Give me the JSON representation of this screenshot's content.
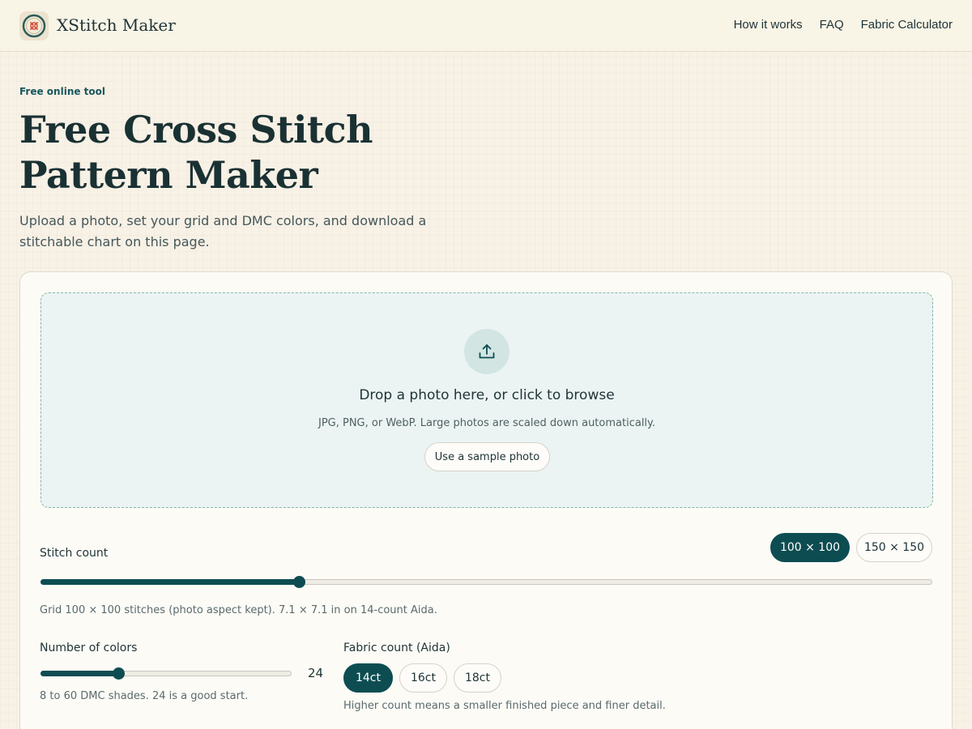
{
  "header": {
    "brand": "XStitch Maker",
    "nav": [
      "How it works",
      "FAQ",
      "Fabric Calculator"
    ]
  },
  "hero": {
    "eyebrow": "Free online tool",
    "title": "Free Cross Stitch Pattern Maker",
    "subtitle": "Upload a photo, set your grid and DMC colors, and download a stitchable chart on this page."
  },
  "upload": {
    "icon": "upload-icon",
    "title": "Drop a photo here, or click to browse",
    "hint": "JPG, PNG, or WebP. Large photos are scaled down automatically.",
    "sample_button": "Use a sample photo"
  },
  "stitch_count": {
    "label": "Stitch count",
    "presets": [
      "100 × 100",
      "150 × 150"
    ],
    "active_preset": "100 × 100",
    "slider_fraction": 0.289,
    "help": "Grid 100 × 100 stitches (photo aspect kept). 7.1 × 7.1 in on 14-count Aida."
  },
  "colors": {
    "label": "Number of colors",
    "value": "24",
    "min": 8,
    "max": 60,
    "help": "8 to 60 DMC shades. 24 is a good start."
  },
  "fabric": {
    "label": "Fabric count (Aida)",
    "options": [
      "14ct",
      "16ct",
      "18ct"
    ],
    "active": "14ct",
    "help": "Higher count means a smaller finished piece and finer detail."
  },
  "theme": {
    "accent": "#0d4d52",
    "background": "#f8f1e6",
    "dropzone_bg": "#ebf4f3"
  }
}
